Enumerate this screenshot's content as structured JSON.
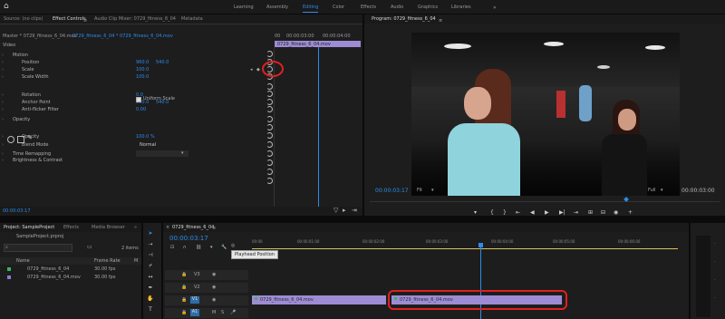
{
  "header": {
    "home_icon": "home-icon",
    "workspaces": [
      "Learning",
      "Assembly",
      "Editing",
      "Color",
      "Effects",
      "Audio",
      "Graphics",
      "Libraries"
    ],
    "active_workspace": "Editing",
    "overflow": "»"
  },
  "source_panel": {
    "tabs": [
      "Source: (no clips)",
      "Effect Controls",
      "Audio Clip Mixer: 0729_fitness_6_04",
      "Metadata"
    ],
    "active_tab": "Effect Controls",
    "menu": "≡",
    "master_label": "Master * 0729_fitness_6_04.mov",
    "clip_label": "0729_fitness_6_04 * 0729_fitness_6_04.mov",
    "timecode_start": "00",
    "timecode_mid": "00:00:03:00",
    "timecode_end": "00:00:04:00",
    "clip_bar_label": "0729_fitness_6_04.mov",
    "current_time": "00:00:03:17",
    "video_header": "Video",
    "uniform_scale": "Uniform Scale",
    "rows": [
      {
        "label": "Motion",
        "v1": "",
        "v2": ""
      },
      {
        "label": "Position",
        "v1": "960.0",
        "v2": "540.0"
      },
      {
        "label": "Scale",
        "v1": "100.0",
        "v2": ""
      },
      {
        "label": "Scale Width",
        "v1": "100.0",
        "v2": ""
      },
      {
        "label": "",
        "v1": "",
        "v2": ""
      },
      {
        "label": "Rotation",
        "v1": "0.0",
        "v2": ""
      },
      {
        "label": "Anchor Point",
        "v1": "960.0",
        "v2": "540.0"
      },
      {
        "label": "Anti-flicker Filter",
        "v1": "0.00",
        "v2": ""
      },
      {
        "label": "Opacity",
        "v1": "",
        "v2": ""
      },
      {
        "label": "",
        "v1": "",
        "v2": ""
      },
      {
        "label": "Opacity",
        "v1": "100.0 %",
        "v2": ""
      },
      {
        "label": "Blend Mode",
        "v1": "Normal",
        "v2": ""
      },
      {
        "label": "Time Remapping",
        "v1": "",
        "v2": ""
      },
      {
        "label": "Brightness & Contrast",
        "v1": "",
        "v2": ""
      }
    ]
  },
  "program_panel": {
    "title": "Program: 0729_fitness_6_04",
    "menu": "≡",
    "timecode": "00:00:03:17",
    "fit": "Fit",
    "quality": "Full",
    "duration": "00:00:03:00",
    "controls": [
      "▾",
      "{",
      "}",
      "⇤",
      "◀",
      "▶",
      "▶|",
      "⇥",
      "⊞",
      "⊟",
      "◉",
      "+"
    ]
  },
  "project_panel": {
    "tabs": [
      "Project: SampleProject",
      "Effects",
      "Media Browser",
      "»"
    ],
    "active_tab": "Project: SampleProject",
    "file": "SampleProject.prproj",
    "item_count": "2 items",
    "columns": [
      "Name",
      "Frame Rate",
      "M"
    ],
    "items": [
      {
        "name": "0729_fitness_6_04",
        "rate": "30.00 fps",
        "color": "#3cb45a"
      },
      {
        "name": "0729_fitness_6_04.mov",
        "rate": "30.00 fps",
        "color": "#8c7ccf"
      }
    ]
  },
  "timeline": {
    "sequence_tab": "0729_fitness_6_04",
    "close": "×",
    "menu": "≡",
    "timecode": "00:00:03:17",
    "ruler": [
      "00:00",
      "00:00:01:00",
      "00:00:02:00",
      "00:00:03:00",
      "00:00:04:00",
      "00:00:05:00",
      "00:00:06:00"
    ],
    "tooltip": "Playhead Position",
    "tracks": [
      "V3",
      "V2",
      "V1",
      "A1",
      "A2"
    ],
    "clips": [
      {
        "label": "0729_fitness_6_04.mov"
      },
      {
        "label": "0729_fitness_6_04.mov"
      }
    ]
  },
  "colors": {
    "accent": "#2d8ceb",
    "highlight": "#e02020",
    "clip": "#9d8cd4"
  }
}
